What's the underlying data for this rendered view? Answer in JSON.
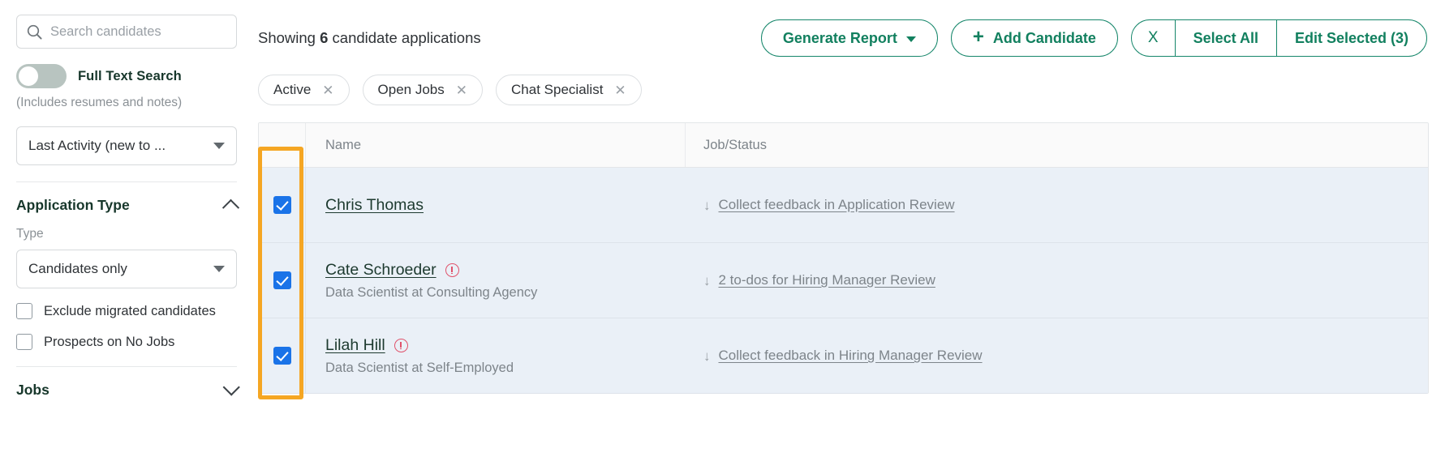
{
  "sidebar": {
    "search": {
      "placeholder": "Search candidates",
      "value": "",
      "icon": "search-icon"
    },
    "full_text_search": {
      "label": "Full Text Search",
      "sub_label": "(Includes resumes and notes)",
      "enabled": false
    },
    "sort_select": {
      "value": "Last Activity (new to ...",
      "icon": "chevron-down-icon"
    },
    "application_type": {
      "title": "Application Type",
      "collapse_icon": "chevron-up-icon",
      "field_label": "Type",
      "type_select": {
        "value": "Candidates only",
        "icon": "chevron-down-icon"
      },
      "checkboxes": [
        {
          "label": "Exclude migrated candidates",
          "checked": false
        },
        {
          "label": "Prospects on No Jobs",
          "checked": false
        }
      ]
    },
    "jobs_section": {
      "title": "Jobs",
      "collapse_icon": "chevron-down-icon"
    }
  },
  "header": {
    "showing_prefix": "Showing ",
    "showing_count": "6",
    "showing_suffix": " candidate applications",
    "generate_report": {
      "label": "Generate Report",
      "icon": "chevron-down-icon"
    },
    "add_candidate": {
      "label": "Add Candidate",
      "icon": "plus-icon"
    },
    "selection_group": {
      "close_label": "X",
      "select_all_label": "Select All",
      "edit_selected_label": "Edit Selected (3)"
    }
  },
  "filter_chips": [
    {
      "label": "Active",
      "remove_icon": "close-icon"
    },
    {
      "label": "Open Jobs",
      "remove_icon": "close-icon"
    },
    {
      "label": "Chat Specialist",
      "remove_icon": "close-icon"
    }
  ],
  "table": {
    "columns": {
      "checkbox": "",
      "name": "Name",
      "job_status": "Job/Status"
    },
    "rows": [
      {
        "checked": true,
        "name": "Chris Thomas",
        "has_warning": false,
        "subtitle": "",
        "job_status": "Collect feedback in Application Review",
        "job_status_icon": "down-arrow-icon"
      },
      {
        "checked": true,
        "name": "Cate Schroeder",
        "has_warning": true,
        "subtitle": "Data Scientist at Consulting Agency",
        "job_status": "2 to-dos for Hiring Manager Review",
        "job_status_icon": "down-arrow-icon"
      },
      {
        "checked": true,
        "name": "Lilah Hill",
        "has_warning": true,
        "subtitle": "Data Scientist at Self-Employed",
        "job_status": "Collect feedback in Hiring Manager Review",
        "job_status_icon": "down-arrow-icon"
      }
    ]
  },
  "annotation": {
    "highlight_color": "#f5a623",
    "target": "checkbox-column"
  },
  "colors": {
    "brand_green": "#12805f",
    "dark_green_text": "#17372b",
    "checkbox_blue": "#1a73e8",
    "row_selected_bg": "#eaf0f7",
    "muted_text": "#7d848a",
    "warning_red": "#e0526b"
  }
}
